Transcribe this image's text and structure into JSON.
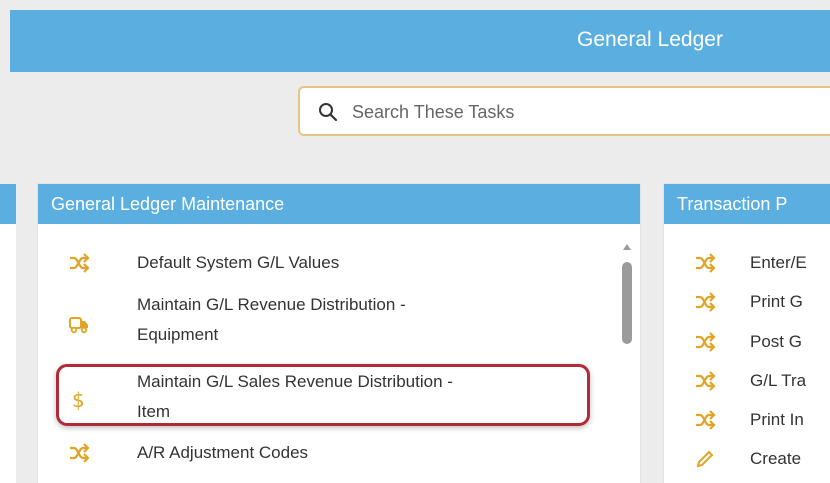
{
  "header": {
    "title": "General Ledger"
  },
  "search": {
    "placeholder": "Search These Tasks"
  },
  "maintenance_panel": {
    "title": "General Ledger Maintenance",
    "items": [
      {
        "label": "Default System G/L Values",
        "icon": "shuffle-icon"
      },
      {
        "label_line1": "Maintain G/L Revenue Distribution -",
        "label_line2": "Equipment",
        "icon": "truck-icon"
      },
      {
        "label_line1": "Maintain G/L Sales Revenue Distribution -",
        "label_line2": "Item",
        "icon": "dollar-icon"
      },
      {
        "label": "A/R Adjustment Codes",
        "icon": "shuffle-icon"
      }
    ]
  },
  "transaction_panel": {
    "title": "Transaction P",
    "items": [
      {
        "label": "Enter/E",
        "icon": "shuffle-icon"
      },
      {
        "label": "Print G",
        "icon": "shuffle-icon"
      },
      {
        "label": "Post G",
        "icon": "shuffle-icon"
      },
      {
        "label": "G/L Tra",
        "icon": "shuffle-icon"
      },
      {
        "label": "Print In",
        "icon": "shuffle-icon"
      },
      {
        "label": "Create",
        "icon": "pencil-icon"
      }
    ]
  },
  "colors": {
    "header": "#5aaee0",
    "icon": "#e0a526",
    "highlight": "#b22a37"
  }
}
